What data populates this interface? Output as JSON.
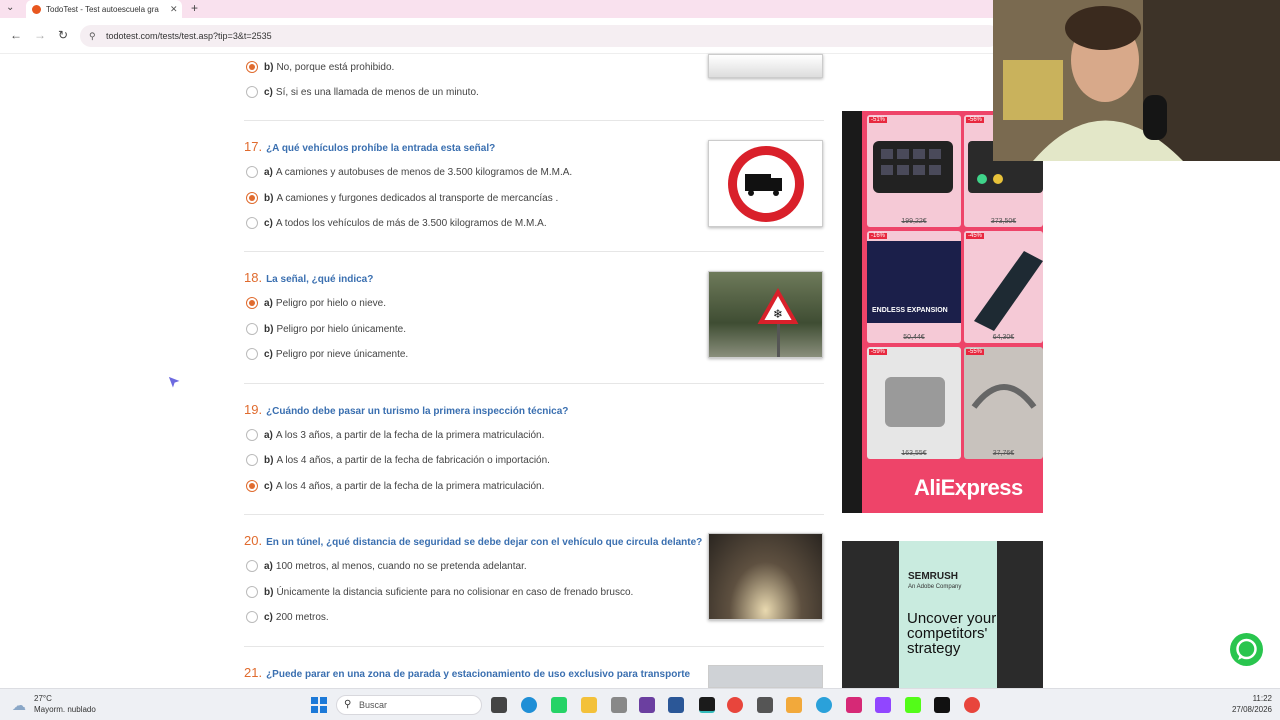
{
  "browser": {
    "tab_title": "TodoTest - Test autoescuela gra",
    "url": "todotest.com/tests/test.asp?tip=3&t=2535"
  },
  "questions": [
    {
      "number": "",
      "title": "",
      "answers": [
        {
          "letter": "b)",
          "text": "No, porque está prohibido.",
          "selected": true
        },
        {
          "letter": "c)",
          "text": "Sí, si es una llamada de menos de un minuto.",
          "selected": false
        }
      ]
    },
    {
      "number": "17.",
      "title": "¿A qué vehículos prohíbe la entrada esta señal?",
      "answers": [
        {
          "letter": "a)",
          "text": "A camiones y autobuses de menos de 3.500 kilogramos de M.M.A.",
          "selected": false
        },
        {
          "letter": "b)",
          "text": "A camiones y furgones dedicados al transporte de mercancías .",
          "selected": true
        },
        {
          "letter": "c)",
          "text": "A todos los vehículos de más de 3.500 kilogramos de M.M.A.",
          "selected": false
        }
      ]
    },
    {
      "number": "18.",
      "title": "La señal, ¿qué indica?",
      "answers": [
        {
          "letter": "a)",
          "text": "Peligro por hielo o nieve.",
          "selected": true
        },
        {
          "letter": "b)",
          "text": "Peligro por hielo únicamente.",
          "selected": false
        },
        {
          "letter": "c)",
          "text": "Peligro por nieve únicamente.",
          "selected": false
        }
      ]
    },
    {
      "number": "19.",
      "title": "¿Cuándo debe pasar un turismo la primera inspección técnica?",
      "answers": [
        {
          "letter": "a)",
          "text": "A los 3 años, a partir de la fecha de la primera matriculación.",
          "selected": false
        },
        {
          "letter": "b)",
          "text": "A los 4 años, a partir de la fecha de fabricación o importación.",
          "selected": false
        },
        {
          "letter": "c)",
          "text": "A los 4 años, a partir de la fecha de la primera matriculación.",
          "selected": true
        }
      ]
    },
    {
      "number": "20.",
      "title": "En un túnel, ¿qué distancia de seguridad se debe dejar con el vehículo que circula delante?",
      "answers": [
        {
          "letter": "a)",
          "text": "100 metros, al menos, cuando no se pretenda adelantar.",
          "selected": false
        },
        {
          "letter": "b)",
          "text": "Únicamente la distancia suficiente para no colisionar en caso de frenado brusco.",
          "selected": false
        },
        {
          "letter": "c)",
          "text": "200 metros.",
          "selected": false
        }
      ]
    },
    {
      "number": "21.",
      "title": "¿Puede parar en una zona de parada y estacionamiento de uso exclusivo para transporte",
      "answers": []
    }
  ],
  "ads": {
    "aliexpress": {
      "brand": "AliExpress",
      "products": [
        {
          "discount": "-51%",
          "price": "199,22€"
        },
        {
          "discount": "-56%",
          "price": "373,50€"
        },
        {
          "discount": "-16%",
          "price": "50,44€",
          "caption": "ENDLESS EXPANSION"
        },
        {
          "discount": "-45%",
          "price": "64,30€"
        },
        {
          "discount": "-59%",
          "price": "163,55€"
        },
        {
          "discount": "-55%",
          "price": "37,76€"
        }
      ]
    },
    "semrush": {
      "brand": "SEMRUSH",
      "sub": "An Adobe Company",
      "headline": "Uncover your competitors' strategy"
    }
  },
  "taskbar": {
    "temp": "27°C",
    "weather": "Mayorm. nublado",
    "search_placeholder": "Buscar",
    "time": "11:22",
    "date": "27/08/2026"
  },
  "colors": {
    "accent": "#e06b2e",
    "question_title": "#3a6fb0",
    "ali_bg": "#ee4469",
    "whatsapp": "#29c54e"
  }
}
